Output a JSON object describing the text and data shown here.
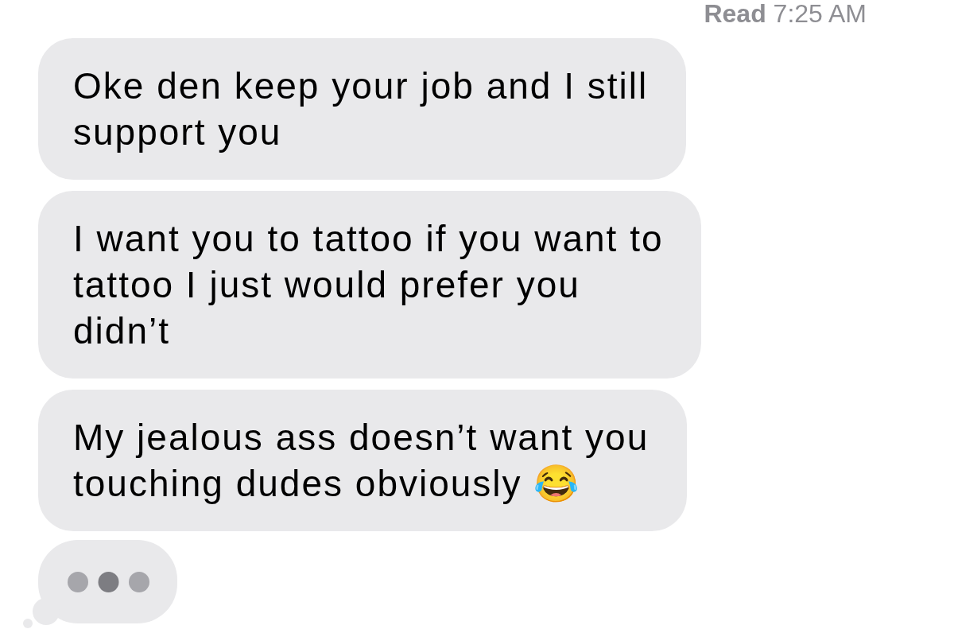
{
  "read_receipt": {
    "text": "**Read** 7:25 AM"
  },
  "messages": [
    {
      "text": "Oke den keep your job and I still support you"
    },
    {
      "text": "I want you to tattoo if you want to tattoo I just would prefer you didn’t"
    },
    {
      "text": "My jealous ass doesn’t want you touching dudes obviously 😂"
    }
  ],
  "typing_indicator": {
    "dots": [
      {
        "highlighted": false
      },
      {
        "highlighted": true
      },
      {
        "highlighted": false
      }
    ]
  }
}
